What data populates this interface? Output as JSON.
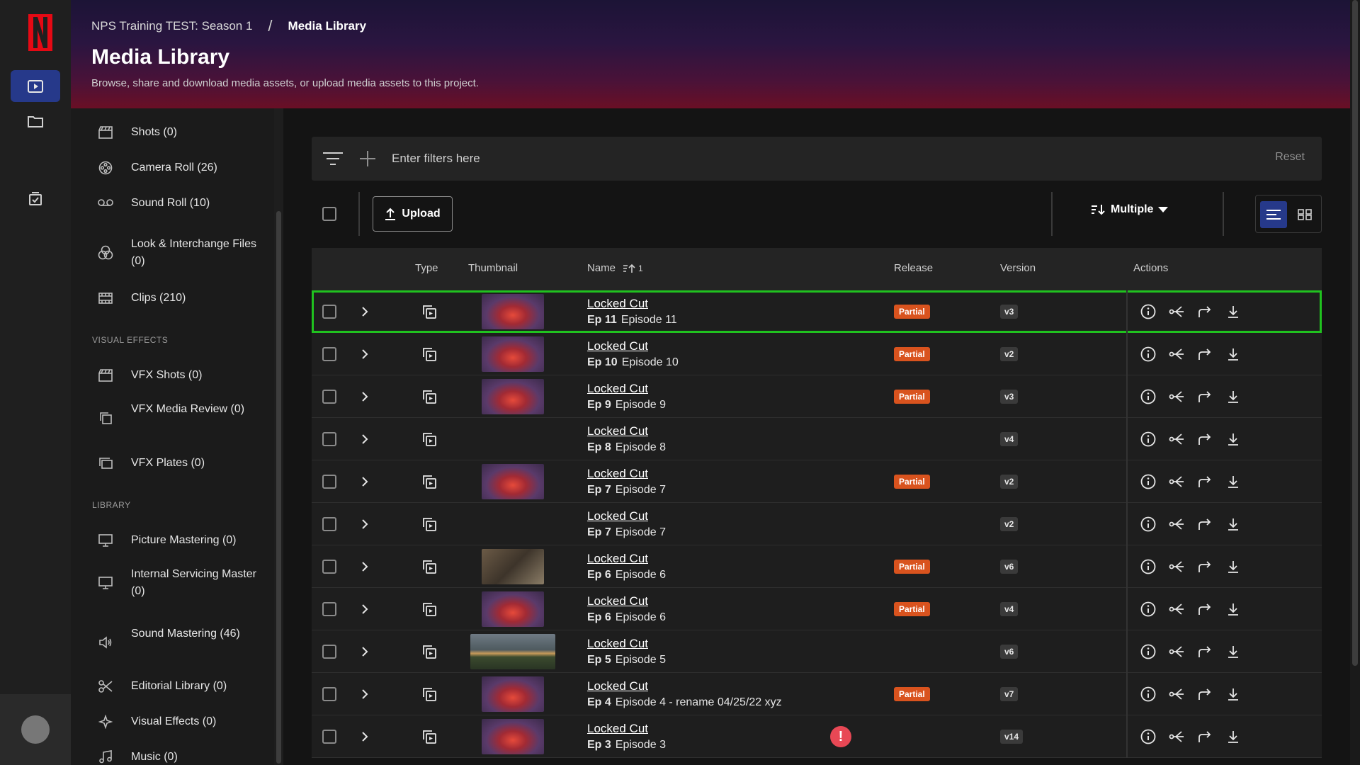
{
  "breadcrumb": {
    "project": "NPS Training TEST: Season 1",
    "separator": "/",
    "current": "Media Library"
  },
  "page": {
    "title": "Media Library",
    "subtitle": "Browse, share and download media assets, or upload media assets to this project."
  },
  "sidebar": {
    "items_top": [
      {
        "label": "Shots (0)",
        "icon": "clapper-icon"
      },
      {
        "label": "Camera Roll (26)",
        "icon": "film-reel-icon"
      },
      {
        "label": "Sound Roll (10)",
        "icon": "tape-icon"
      },
      {
        "label": "Look & Interchange Files (0)",
        "icon": "color-circles-icon"
      },
      {
        "label": "Clips (210)",
        "icon": "film-strip-icon"
      }
    ],
    "section_vfx": "VISUAL EFFECTS",
    "items_vfx": [
      {
        "label": "VFX Shots (0)",
        "icon": "clapper-icon"
      },
      {
        "label": "VFX Media Review (0)",
        "icon": "layers-icon"
      },
      {
        "label": "VFX Plates (0)",
        "icon": "plates-icon"
      }
    ],
    "section_library": "LIBRARY",
    "items_library": [
      {
        "label": "Picture Mastering (0)",
        "icon": "monitor-icon"
      },
      {
        "label": "Internal Servicing Master (0)",
        "icon": "monitor-icon"
      },
      {
        "label": "Sound Mastering (46)",
        "icon": "speaker-icon"
      },
      {
        "label": "Editorial Library (0)",
        "icon": "scissors-icon"
      },
      {
        "label": "Visual Effects (0)",
        "icon": "vfx-icon"
      },
      {
        "label": "Music (0)",
        "icon": "music-icon"
      }
    ]
  },
  "filters": {
    "placeholder": "Enter filters here",
    "reset": "Reset"
  },
  "toolbar": {
    "upload": "Upload",
    "sort": "Multiple"
  },
  "table": {
    "columns": {
      "type": "Type",
      "thumbnail": "Thumbnail",
      "name": "Name",
      "release": "Release",
      "version": "Version",
      "actions": "Actions"
    },
    "name_sort_indicator": "1",
    "rows": [
      {
        "title": "Locked Cut",
        "ep": "Ep 11",
        "episode": "Episode 11",
        "release": "Partial",
        "version": "v3",
        "thumb": "fire",
        "warn": ""
      },
      {
        "title": "Locked Cut",
        "ep": "Ep 10",
        "episode": "Episode 10",
        "release": "Partial",
        "version": "v2",
        "thumb": "fire",
        "warn": ""
      },
      {
        "title": "Locked Cut",
        "ep": "Ep 9",
        "episode": "Episode 9",
        "release": "Partial",
        "version": "v3",
        "thumb": "fire",
        "warn": ""
      },
      {
        "title": "Locked Cut",
        "ep": "Ep 8",
        "episode": "Episode 8",
        "release": "",
        "version": "v4",
        "thumb": "none",
        "warn": ""
      },
      {
        "title": "Locked Cut",
        "ep": "Ep 7",
        "episode": "Episode 7",
        "release": "Partial",
        "version": "v2",
        "thumb": "fire",
        "warn": ""
      },
      {
        "title": "Locked Cut",
        "ep": "Ep 7",
        "episode": "Episode 7",
        "release": "",
        "version": "v2",
        "thumb": "none",
        "warn": ""
      },
      {
        "title": "Locked Cut",
        "ep": "Ep 6",
        "episode": "Episode 6",
        "release": "Partial",
        "version": "v6",
        "thumb": "old",
        "warn": ""
      },
      {
        "title": "Locked Cut",
        "ep": "Ep 6",
        "episode": "Episode 6",
        "release": "Partial",
        "version": "v4",
        "thumb": "fire",
        "warn": ""
      },
      {
        "title": "Locked Cut",
        "ep": "Ep 5",
        "episode": "Episode 5",
        "release": "",
        "version": "v6",
        "thumb": "wide",
        "warn": ""
      },
      {
        "title": "Locked Cut",
        "ep": "Ep 4",
        "episode": "Episode 4 - rename 04/25/22 xyz",
        "release": "Partial",
        "version": "v7",
        "thumb": "fire",
        "warn": ""
      },
      {
        "title": "Locked Cut",
        "ep": "Ep 3",
        "episode": "Episode 3",
        "release": "",
        "version": "v14",
        "thumb": "fire",
        "warn": "!"
      }
    ]
  },
  "colors": {
    "accent": "#26398a",
    "selected_outline": "#20c21f",
    "badge": "#d9531e",
    "brand": "#e50914",
    "warning": "#e84855"
  }
}
